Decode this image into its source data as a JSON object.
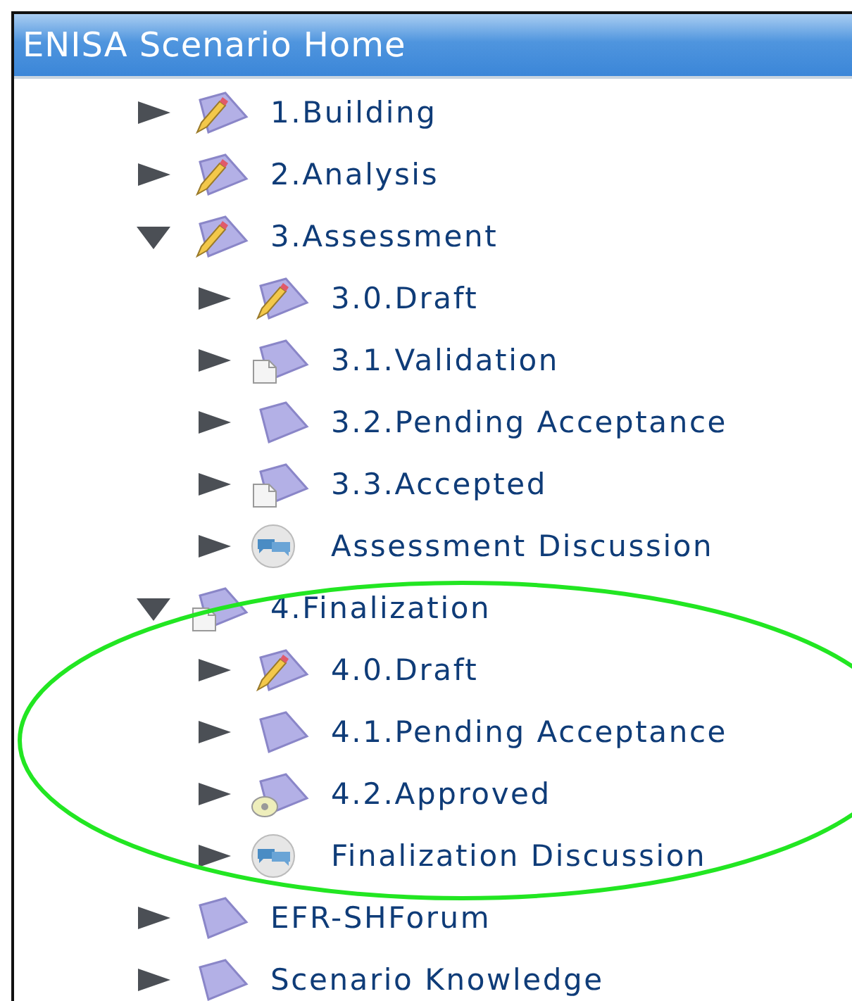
{
  "panel": {
    "title": "ENISA Scenario Home"
  },
  "tree": [
    {
      "label": "1.Building",
      "kind": "draft",
      "expanded": false
    },
    {
      "label": "2.Analysis",
      "kind": "draft",
      "expanded": false
    },
    {
      "label": "3.Assessment",
      "kind": "draft",
      "expanded": true,
      "children": [
        {
          "label": "3.0.Draft",
          "kind": "draft",
          "expanded": false
        },
        {
          "label": "3.1.Validation",
          "kind": "page",
          "expanded": false
        },
        {
          "label": "3.2.Pending Acceptance",
          "kind": "folder",
          "expanded": false
        },
        {
          "label": "3.3.Accepted",
          "kind": "page",
          "expanded": false
        },
        {
          "label": "Assessment Discussion",
          "kind": "discussion",
          "expanded": false
        }
      ]
    },
    {
      "label": "4.Finalization",
      "kind": "page",
      "expanded": true,
      "children": [
        {
          "label": "4.0.Draft",
          "kind": "draft",
          "expanded": false
        },
        {
          "label": "4.1.Pending Acceptance",
          "kind": "folder",
          "expanded": false
        },
        {
          "label": "4.2.Approved",
          "kind": "disc",
          "expanded": false
        },
        {
          "label": "Finalization Discussion",
          "kind": "discussion",
          "expanded": false
        }
      ]
    },
    {
      "label": "EFR-SHForum",
      "kind": "folder",
      "expanded": false
    },
    {
      "label": "Scenario Knowledge",
      "kind": "folder",
      "expanded": false
    }
  ]
}
